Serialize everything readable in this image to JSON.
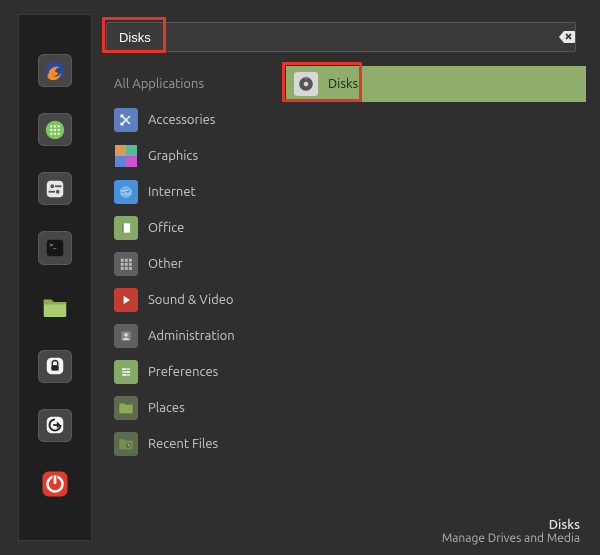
{
  "search": {
    "value": "Disks"
  },
  "categories": {
    "header": "All Applications",
    "items": [
      {
        "label": "Accessories"
      },
      {
        "label": "Graphics"
      },
      {
        "label": "Internet"
      },
      {
        "label": "Office"
      },
      {
        "label": "Other"
      },
      {
        "label": "Sound & Video"
      },
      {
        "label": "Administration"
      },
      {
        "label": "Preferences"
      },
      {
        "label": "Places"
      },
      {
        "label": "Recent Files"
      }
    ]
  },
  "apps": {
    "selected": {
      "label": "Disks"
    }
  },
  "footer": {
    "title": "Disks",
    "description": "Manage Drives and Media"
  }
}
